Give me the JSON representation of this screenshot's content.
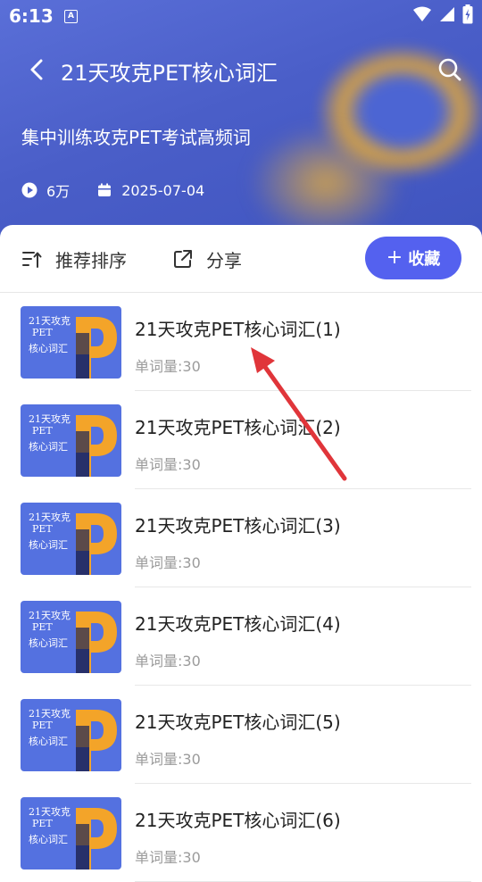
{
  "status_bar": {
    "time": "6:13",
    "notification_icon_letter": "A"
  },
  "header": {
    "title": "21天攻克PET核心词汇",
    "subtitle": "集中训练攻克PET考试高频词",
    "plays": "6万",
    "date": "2025-07-04"
  },
  "toolbar": {
    "sort_label": "推荐排序",
    "share_label": "分享",
    "favorite_label": "收藏",
    "favorite_plus": "+"
  },
  "thumbnail_text": {
    "line1": "21天攻克",
    "line2": "PET",
    "line3": "核心词汇"
  },
  "items": [
    {
      "title": "21天攻克PET核心词汇(1)",
      "count": "单词量:30"
    },
    {
      "title": "21天攻克PET核心词汇(2)",
      "count": "单词量:30"
    },
    {
      "title": "21天攻克PET核心词汇(3)",
      "count": "单词量:30"
    },
    {
      "title": "21天攻克PET核心词汇(4)",
      "count": "单词量:30"
    },
    {
      "title": "21天攻克PET核心词汇(5)",
      "count": "单词量:30"
    },
    {
      "title": "21天攻克PET核心词汇(6)",
      "count": "单词量:30"
    }
  ],
  "colors": {
    "accent": "#5461ef",
    "header_blue": "#4a5ec8",
    "thumb_orange": "#f3a429",
    "annotation_arrow": "#e0353a"
  }
}
